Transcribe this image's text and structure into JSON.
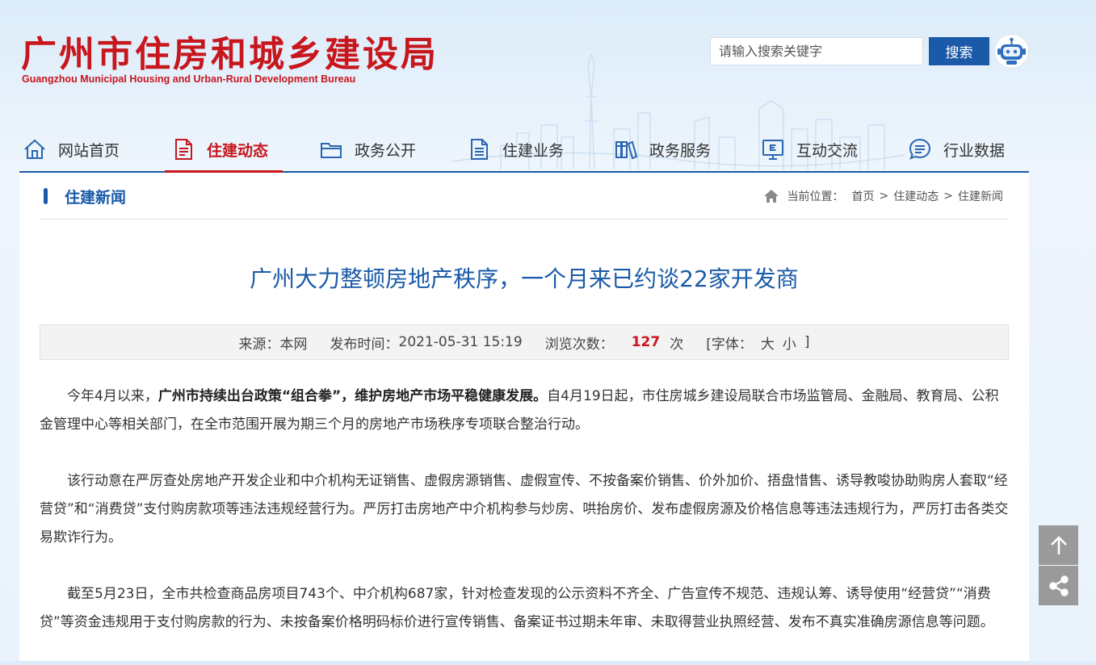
{
  "header": {
    "logo_cn": "广州市住房和城乡建设局",
    "logo_en": "Guangzhou Municipal Housing and Urban-Rural Development Bureau",
    "search_placeholder": "请输入搜索关键字",
    "search_button": "搜索"
  },
  "nav": {
    "items": [
      {
        "label": "网站首页",
        "icon": "home-icon"
      },
      {
        "label": "住建动态",
        "icon": "document-icon",
        "active": true
      },
      {
        "label": "政务公开",
        "icon": "folder-icon"
      },
      {
        "label": "住建业务",
        "icon": "file-list-icon"
      },
      {
        "label": "政务服务",
        "icon": "books-icon"
      },
      {
        "label": "互动交流",
        "icon": "monitor-e-icon"
      },
      {
        "label": "行业数据",
        "icon": "chat-list-icon"
      }
    ]
  },
  "section": {
    "title": "住建新闻"
  },
  "breadcrumb": {
    "label": "当前位置：",
    "items": [
      "首页",
      "住建动态",
      "住建新闻"
    ],
    "sep": ">"
  },
  "article": {
    "title": "广州大力整顿房地产秩序，一个月来已约谈22家开发商",
    "meta": {
      "source_label": "来源：",
      "source": "本网",
      "time_label": "发布时间：",
      "time": "2021-05-31 15:19",
      "views_label": "浏览次数：",
      "views": "127",
      "views_unit": "次",
      "font_open": "[字体：",
      "font_big": "大",
      "font_small": "小",
      "font_close": "]"
    },
    "p1_a": "今年4月以来，",
    "p1_b": "广州市持续出台政策“组合拳”，维护房地产市场平稳健康发展。",
    "p1_c": "自4月19日起，市住房城乡建设局联合市场监管局、金融局、教育局、公积金管理中心等相关部门，在全市范围开展为期三个月的房地产市场秩序专项联合整治行动。",
    "p2": "该行动意在严厉查处房地产开发企业和中介机构无证销售、虚假房源销售、虚假宣传、不按备案价销售、价外加价、捂盘惜售、诱导教唆协助购房人套取“经营贷”和“消费贷”支付购房款项等违法违规经营行为。严厉打击房地产中介机构参与炒房、哄抬房价、发布虚假房源及价格信息等违法违规行为，严厉打击各类交易欺诈行为。",
    "p3": "截至5月23日，全市共检查商品房项目743个、中介机构687家，针对检查发现的公示资料不齐全、广告宣传不规范、违规认筹、诱导使用“经营贷”“消费贷”等资金违规用于支付购房款的行为、未按备案价格明码标价进行宣传销售、备案证书过期未年审、未取得营业执照经营、发布不真实准确房源信息等问题。"
  },
  "side": {
    "top_icon": "arrow-up-icon",
    "share_icon": "share-icon"
  },
  "colors": {
    "brand_red": "#c8161d",
    "brand_blue": "#1a5aa8"
  }
}
